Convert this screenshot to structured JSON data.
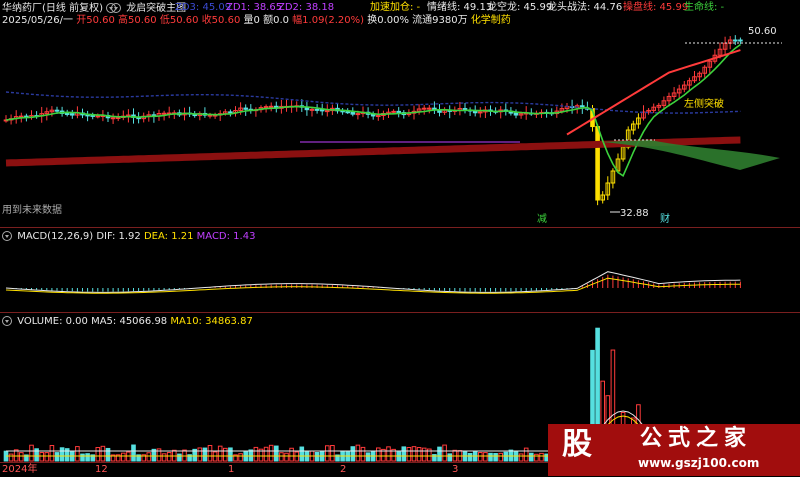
{
  "header": {
    "stock_title": "华纳药厂(日线 前复权)",
    "indicator_name": "龙启突破主图",
    "zd3": "ZD3: 45.09",
    "zd1": "ZD1: 38.65",
    "zd2": "ZD2: 38.18",
    "jiasu": "加速加仓: -",
    "qingxu": "情绪线: 49.13",
    "longkong": "龙空龙: 45.99",
    "longtou": "龙头战法: 44.76",
    "caopan": "操盘线: 45.99",
    "shengming": "生命线: -"
  },
  "ohlc": {
    "date": "2025/05/26/一",
    "open": "开50.60",
    "high": "高50.60",
    "low": "低50.60",
    "close": "收50.60",
    "vol": "量0",
    "amount": "额0.0",
    "change": "幅1.09(2.20%)",
    "turnover": "换0.00%",
    "float": "流通9380万",
    "sector": "化学制药"
  },
  "annotations": {
    "future": "用到未来数据",
    "high_label": "50.60",
    "low_label": "32.88",
    "reduce": "减",
    "wealth": "财",
    "breakout": "左侧突破"
  },
  "macd": {
    "title": "MACD(12,26,9)",
    "dif": "DIF: 1.92",
    "dea": "DEA: 1.21",
    "macd": "MACD: 1.43"
  },
  "volume": {
    "title": "VOLUME: 0.00",
    "ma5": "MA5: 45066.98",
    "ma10": "MA10: 34863.87"
  },
  "xaxis": {
    "y2024": "2024年",
    "m12": "12",
    "m1": "1",
    "m2": "2",
    "m3": "3"
  },
  "watermark": {
    "site": "www.gszj100.com",
    "brand": "公式之家",
    "char": "股"
  },
  "colors": {
    "up": "#ff3b3b",
    "down": "#56e0e0",
    "green": "#3cd23c",
    "purple": "#c040ff",
    "blue": "#2a3a9e",
    "darkred": "#8b1010",
    "yellow": "#ffe000"
  },
  "chart_data": {
    "type": "candlestick",
    "ylabel": "",
    "price_marks": {
      "high": 50.6,
      "low": 32.88
    },
    "lines": [
      "情绪线",
      "龙空龙",
      "龙头战法",
      "操盘线"
    ]
  }
}
